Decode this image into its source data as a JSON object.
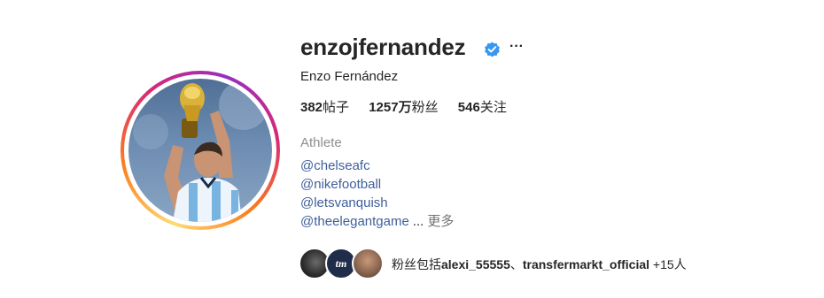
{
  "profile": {
    "username": "enzojfernandez",
    "full_name": "Enzo Fernández",
    "verified_icon": "verified-badge-icon",
    "more_icon": "more-options-icon",
    "more_glyph": "···"
  },
  "stats": {
    "posts": {
      "value": "382",
      "label": "帖子"
    },
    "followers": {
      "value": "1257万",
      "label": "粉丝"
    },
    "following": {
      "value": "546",
      "label": "关注"
    }
  },
  "bio": {
    "category": "Athlete",
    "links": [
      "@chelseafc",
      "@nikefootball",
      "@letsvanquish"
    ],
    "last_link": "@theelegantgame",
    "ellipsis": "...",
    "more_label": "更多"
  },
  "followed_by": {
    "prefix": "粉丝包括",
    "names": [
      "alexi_55555",
      "transfermarkt_official"
    ],
    "separator": "、",
    "suffix": "+15人",
    "tm_logo_text": "tm"
  },
  "colors": {
    "link": "#3f5f9a",
    "verified": "#3897f0",
    "muted": "#8e8e8e"
  }
}
